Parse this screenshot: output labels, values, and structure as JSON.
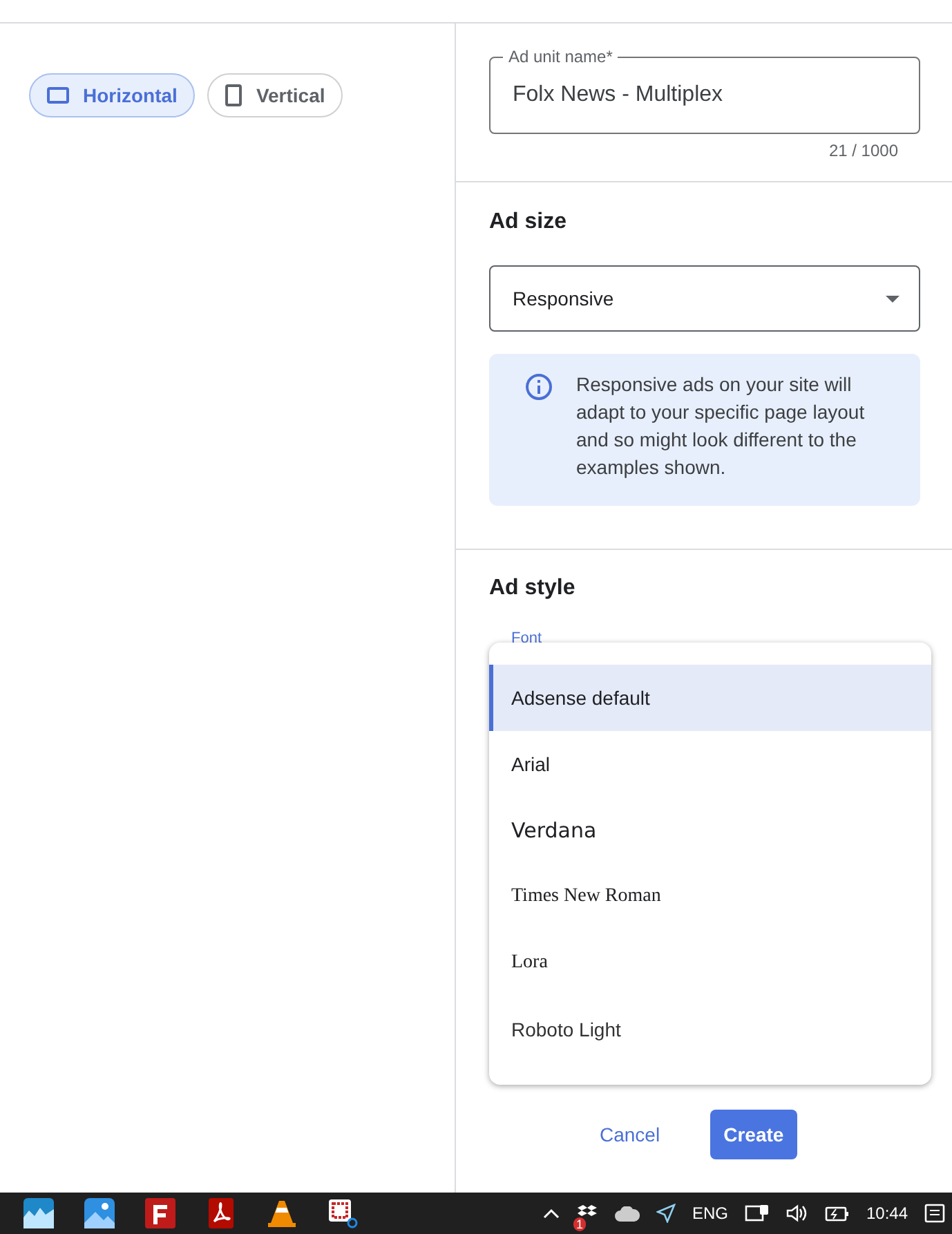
{
  "orientation_toggle": [
    {
      "label": "Horizontal",
      "kind": "landscape",
      "selected": true
    },
    {
      "label": "Vertical",
      "kind": "portrait",
      "selected": false
    }
  ],
  "ad_unit_name": {
    "label": "Ad unit name*",
    "value": "Folx News - Multiplex",
    "counter": "21 / 1000"
  },
  "ad_size": {
    "heading": "Ad size",
    "dropdown": "Responsive",
    "info": "Responsive ads on your site will adapt to your specific page layout and so might look different to the examples shown."
  },
  "ad_style": {
    "heading": "Ad style",
    "font_label": "Font",
    "font_menu": [
      {
        "label": "Adsense default",
        "kind": "sans",
        "selected": true
      },
      {
        "label": "Arial",
        "kind": "sans",
        "selected": false
      },
      {
        "label": "Verdana",
        "kind": "wide",
        "selected": false
      },
      {
        "label": "Times New Roman",
        "kind": "serif",
        "selected": false
      },
      {
        "label": "Lora",
        "kind": "serif",
        "selected": false
      },
      {
        "label": "Roboto Light",
        "kind": "light",
        "selected": false
      }
    ]
  },
  "buttons": [
    {
      "label": "Cancel",
      "kind": "text"
    },
    {
      "label": "Create",
      "kind": "filled"
    }
  ],
  "taskbar": {
    "tray_badge": "1",
    "language": "ENG",
    "time": "10:44"
  }
}
